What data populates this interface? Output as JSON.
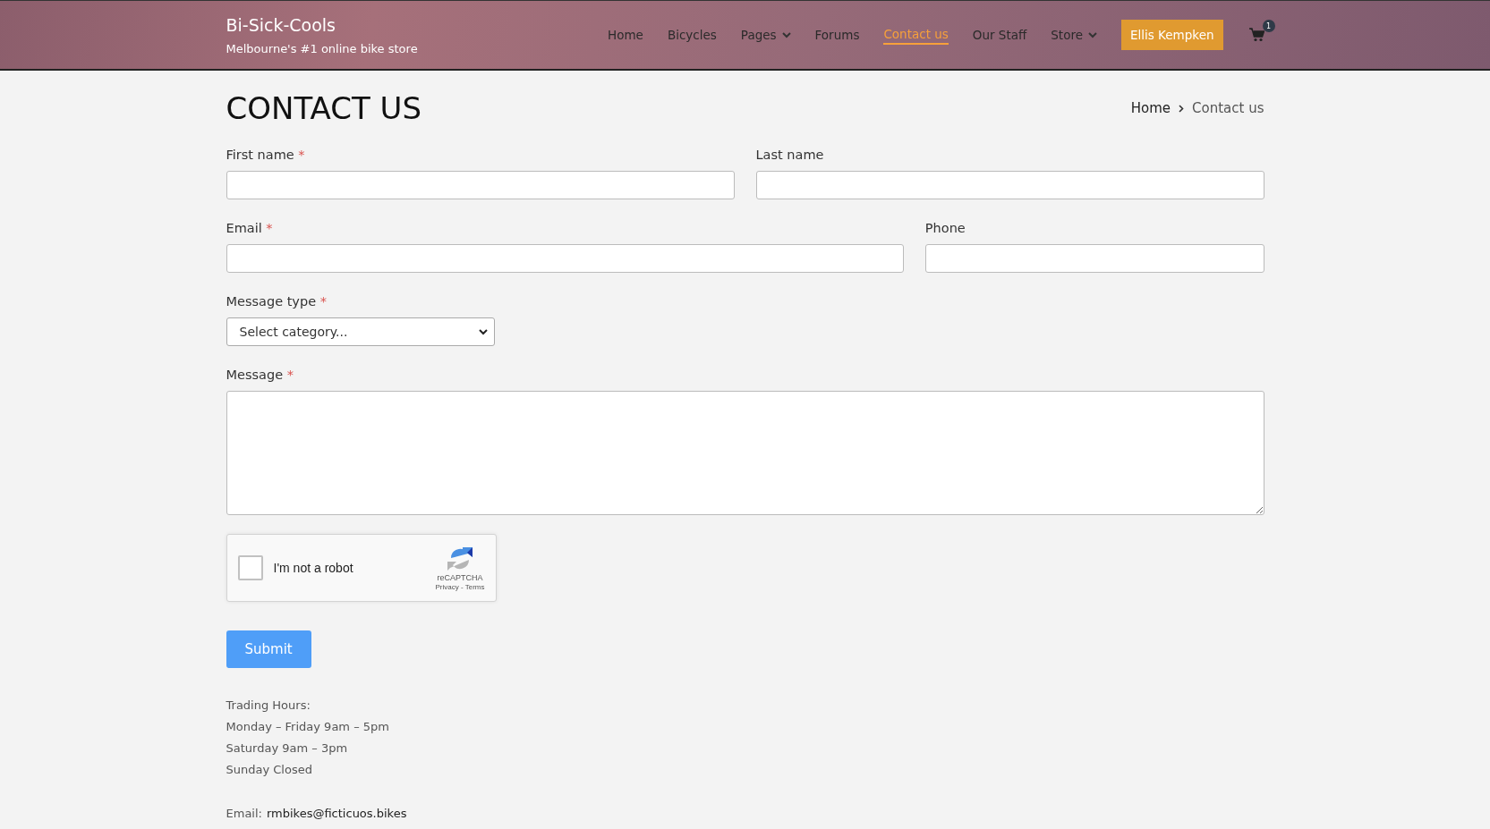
{
  "header": {
    "brand": "Bi-Sick-Cools",
    "tagline": "Melbourne's #1 online bike store",
    "nav": [
      {
        "kind": "link",
        "label": "Home",
        "selected": false
      },
      {
        "kind": "link",
        "label": "Bicycles",
        "selected": false
      },
      {
        "kind": "dropdown",
        "label": "Pages",
        "selected": false
      },
      {
        "kind": "link",
        "label": "Forums",
        "selected": false
      },
      {
        "kind": "link",
        "label": "Contact us",
        "selected": true
      },
      {
        "kind": "link",
        "label": "Our Staff",
        "selected": false
      },
      {
        "kind": "dropdown",
        "label": "Store",
        "selected": false
      },
      {
        "kind": "button",
        "label": "Ellis Kempken"
      },
      {
        "kind": "cart",
        "label": "1"
      }
    ]
  },
  "page": {
    "title": "CONTACT US",
    "breadcrumb": [
      {
        "label": "Home"
      },
      {
        "label": "Contact us"
      }
    ]
  },
  "form": {
    "rows": [
      [
        {
          "kind": "input",
          "label": "First name",
          "required": true
        },
        {
          "kind": "input",
          "label": "Last name",
          "required": false
        }
      ],
      [
        {
          "kind": "input",
          "label": "Email",
          "required": true
        },
        {
          "kind": "input",
          "label": "Phone",
          "required": false
        }
      ],
      [
        {
          "kind": "select",
          "label": "Message type",
          "required": true,
          "value": "Select category..."
        }
      ],
      [
        {
          "kind": "textarea",
          "label": "Message",
          "required": true
        }
      ]
    ],
    "required_mark": "*",
    "captcha": {
      "label": "I'm not a robot",
      "checked": false,
      "brand": "reCAPTCHA",
      "links": "Privacy - Terms"
    },
    "submit": "Submit"
  },
  "footer": {
    "hours": [
      "Trading Hours:",
      "Monday – Friday 9am – 5pm",
      "Saturday 9am – 3pm",
      "Sunday Closed"
    ],
    "email_label": "Email:",
    "email": "rmbikes@ficticuos.bikes"
  }
}
